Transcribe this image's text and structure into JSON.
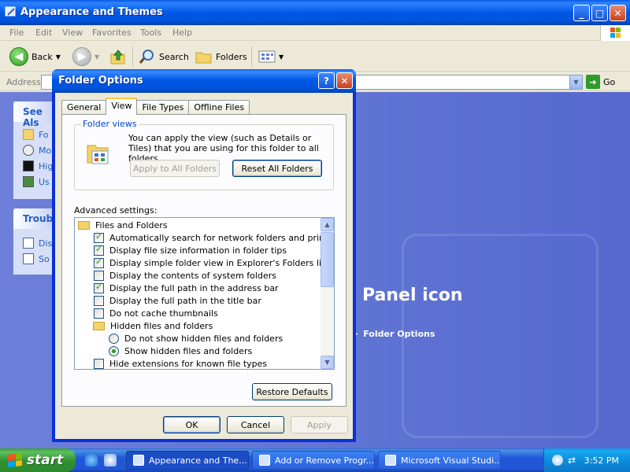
{
  "window": {
    "title": "Appearance and Themes",
    "minimize": "_",
    "maximize": "□",
    "close": "✕"
  },
  "menu": [
    "File",
    "Edit",
    "View",
    "Favorites",
    "Tools",
    "Help"
  ],
  "toolbar": {
    "back": "Back",
    "search": "Search",
    "folders": "Folders"
  },
  "address": {
    "label": "Address",
    "go": "Go"
  },
  "sidebar": {
    "see_also_title": "See Als",
    "see_also_items": [
      "Fo",
      "Mo",
      "Hig",
      "Us"
    ],
    "troubleshoot_title": "Troubl",
    "troubleshoot_items": [
      "Dis",
      "So"
    ]
  },
  "main": {
    "panel_icon_text": "Panel icon",
    "folder_options_link": "Folder Options"
  },
  "dialog": {
    "title": "Folder Options",
    "help_btn": "?",
    "close_btn": "✕",
    "tabs": [
      "General",
      "View",
      "File Types",
      "Offline Files"
    ],
    "active_tab": "View",
    "folder_views": {
      "legend": "Folder views",
      "text": "You can apply the view (such as Details or Tiles) that you are using for this folder to all folders.",
      "apply_all": "Apply to All Folders",
      "reset_all": "Reset All Folders"
    },
    "advanced_label": "Advanced settings:",
    "advanced_items": [
      {
        "type": "folder",
        "label": "Files and Folders",
        "indent": 0
      },
      {
        "type": "check",
        "label": "Automatically search for network folders and printers",
        "checked": true,
        "indent": 1
      },
      {
        "type": "check",
        "label": "Display file size information in folder tips",
        "checked": true,
        "indent": 1
      },
      {
        "type": "check",
        "label": "Display simple folder view in Explorer's Folders list",
        "checked": true,
        "indent": 1
      },
      {
        "type": "check",
        "label": "Display the contents of system folders",
        "checked": false,
        "indent": 1
      },
      {
        "type": "check",
        "label": "Display the full path in the address bar",
        "checked": true,
        "indent": 1
      },
      {
        "type": "check",
        "label": "Display the full path in the title bar",
        "checked": false,
        "indent": 1
      },
      {
        "type": "check",
        "label": "Do not cache thumbnails",
        "checked": false,
        "indent": 1
      },
      {
        "type": "folder",
        "label": "Hidden files and folders",
        "indent": 1
      },
      {
        "type": "radio",
        "label": "Do not show hidden files and folders",
        "checked": false,
        "indent": 2
      },
      {
        "type": "radio",
        "label": "Show hidden files and folders",
        "checked": true,
        "indent": 2
      },
      {
        "type": "check",
        "label": "Hide extensions for known file types",
        "checked": false,
        "indent": 1
      }
    ],
    "restore_defaults": "Restore Defaults",
    "ok": "OK",
    "cancel": "Cancel",
    "apply": "Apply"
  },
  "taskbar": {
    "start": "start",
    "tasks": [
      {
        "label": "Appearance and The...",
        "active": true
      },
      {
        "label": "Add or Remove Progr...",
        "active": false
      },
      {
        "label": "Microsoft Visual Studi...",
        "active": false
      }
    ],
    "clock": "3:52 PM"
  },
  "colors": {
    "xp_blue": "#0058e6",
    "link_blue": "#215dc6",
    "check_green": "#21a121"
  }
}
